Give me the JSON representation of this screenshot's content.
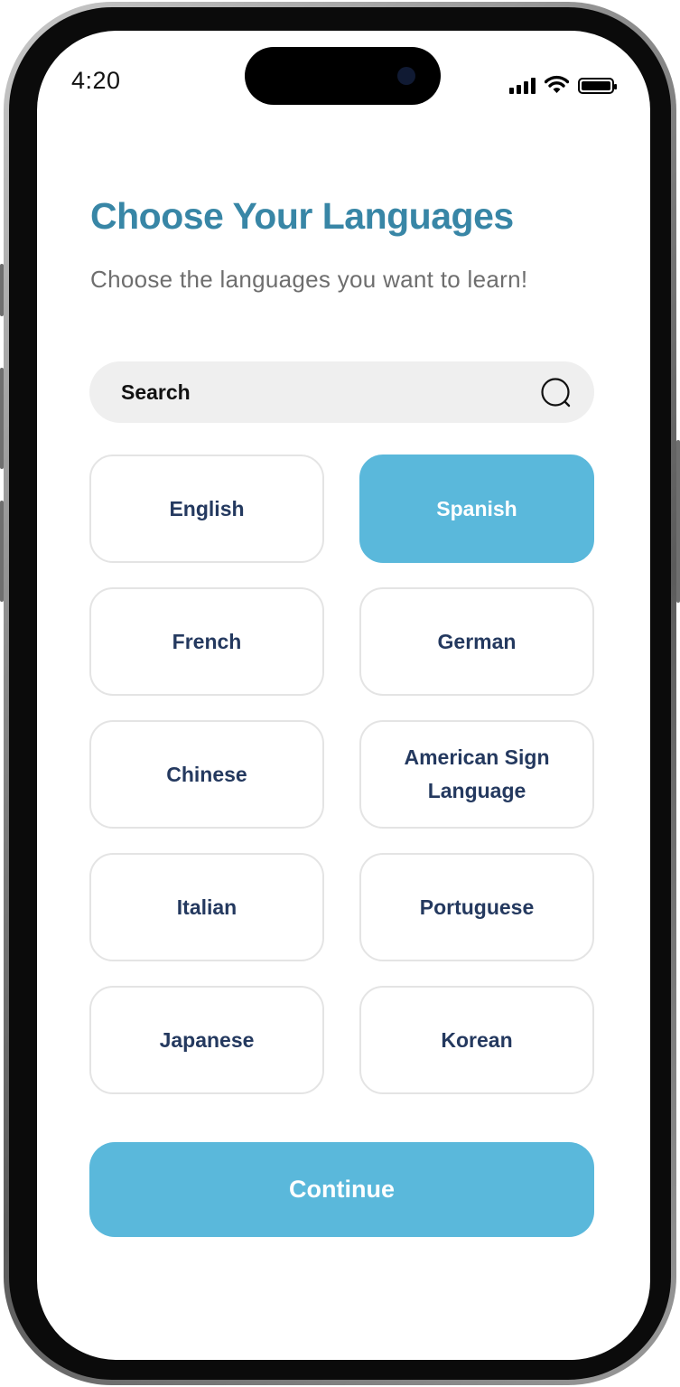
{
  "status_bar": {
    "time": "4:20"
  },
  "header": {
    "title": "Choose Your Languages",
    "subtitle": "Choose the languages you want to learn!"
  },
  "search": {
    "placeholder": "Search",
    "icon": "search-icon"
  },
  "languages": [
    {
      "label": "English",
      "selected": false
    },
    {
      "label": "Spanish",
      "selected": true
    },
    {
      "label": "French",
      "selected": false
    },
    {
      "label": "German",
      "selected": false
    },
    {
      "label": "Chinese",
      "selected": false
    },
    {
      "label": "American Sign Language",
      "selected": false
    },
    {
      "label": "Italian",
      "selected": false
    },
    {
      "label": "Portuguese",
      "selected": false
    },
    {
      "label": "Japanese",
      "selected": false
    },
    {
      "label": "Korean",
      "selected": false
    }
  ],
  "continue_label": "Continue",
  "colors": {
    "title": "#3886a6",
    "accent": "#5ab8db",
    "language_text": "#24395f",
    "subtitle": "#6e6e6e",
    "search_bg": "#efefef"
  }
}
